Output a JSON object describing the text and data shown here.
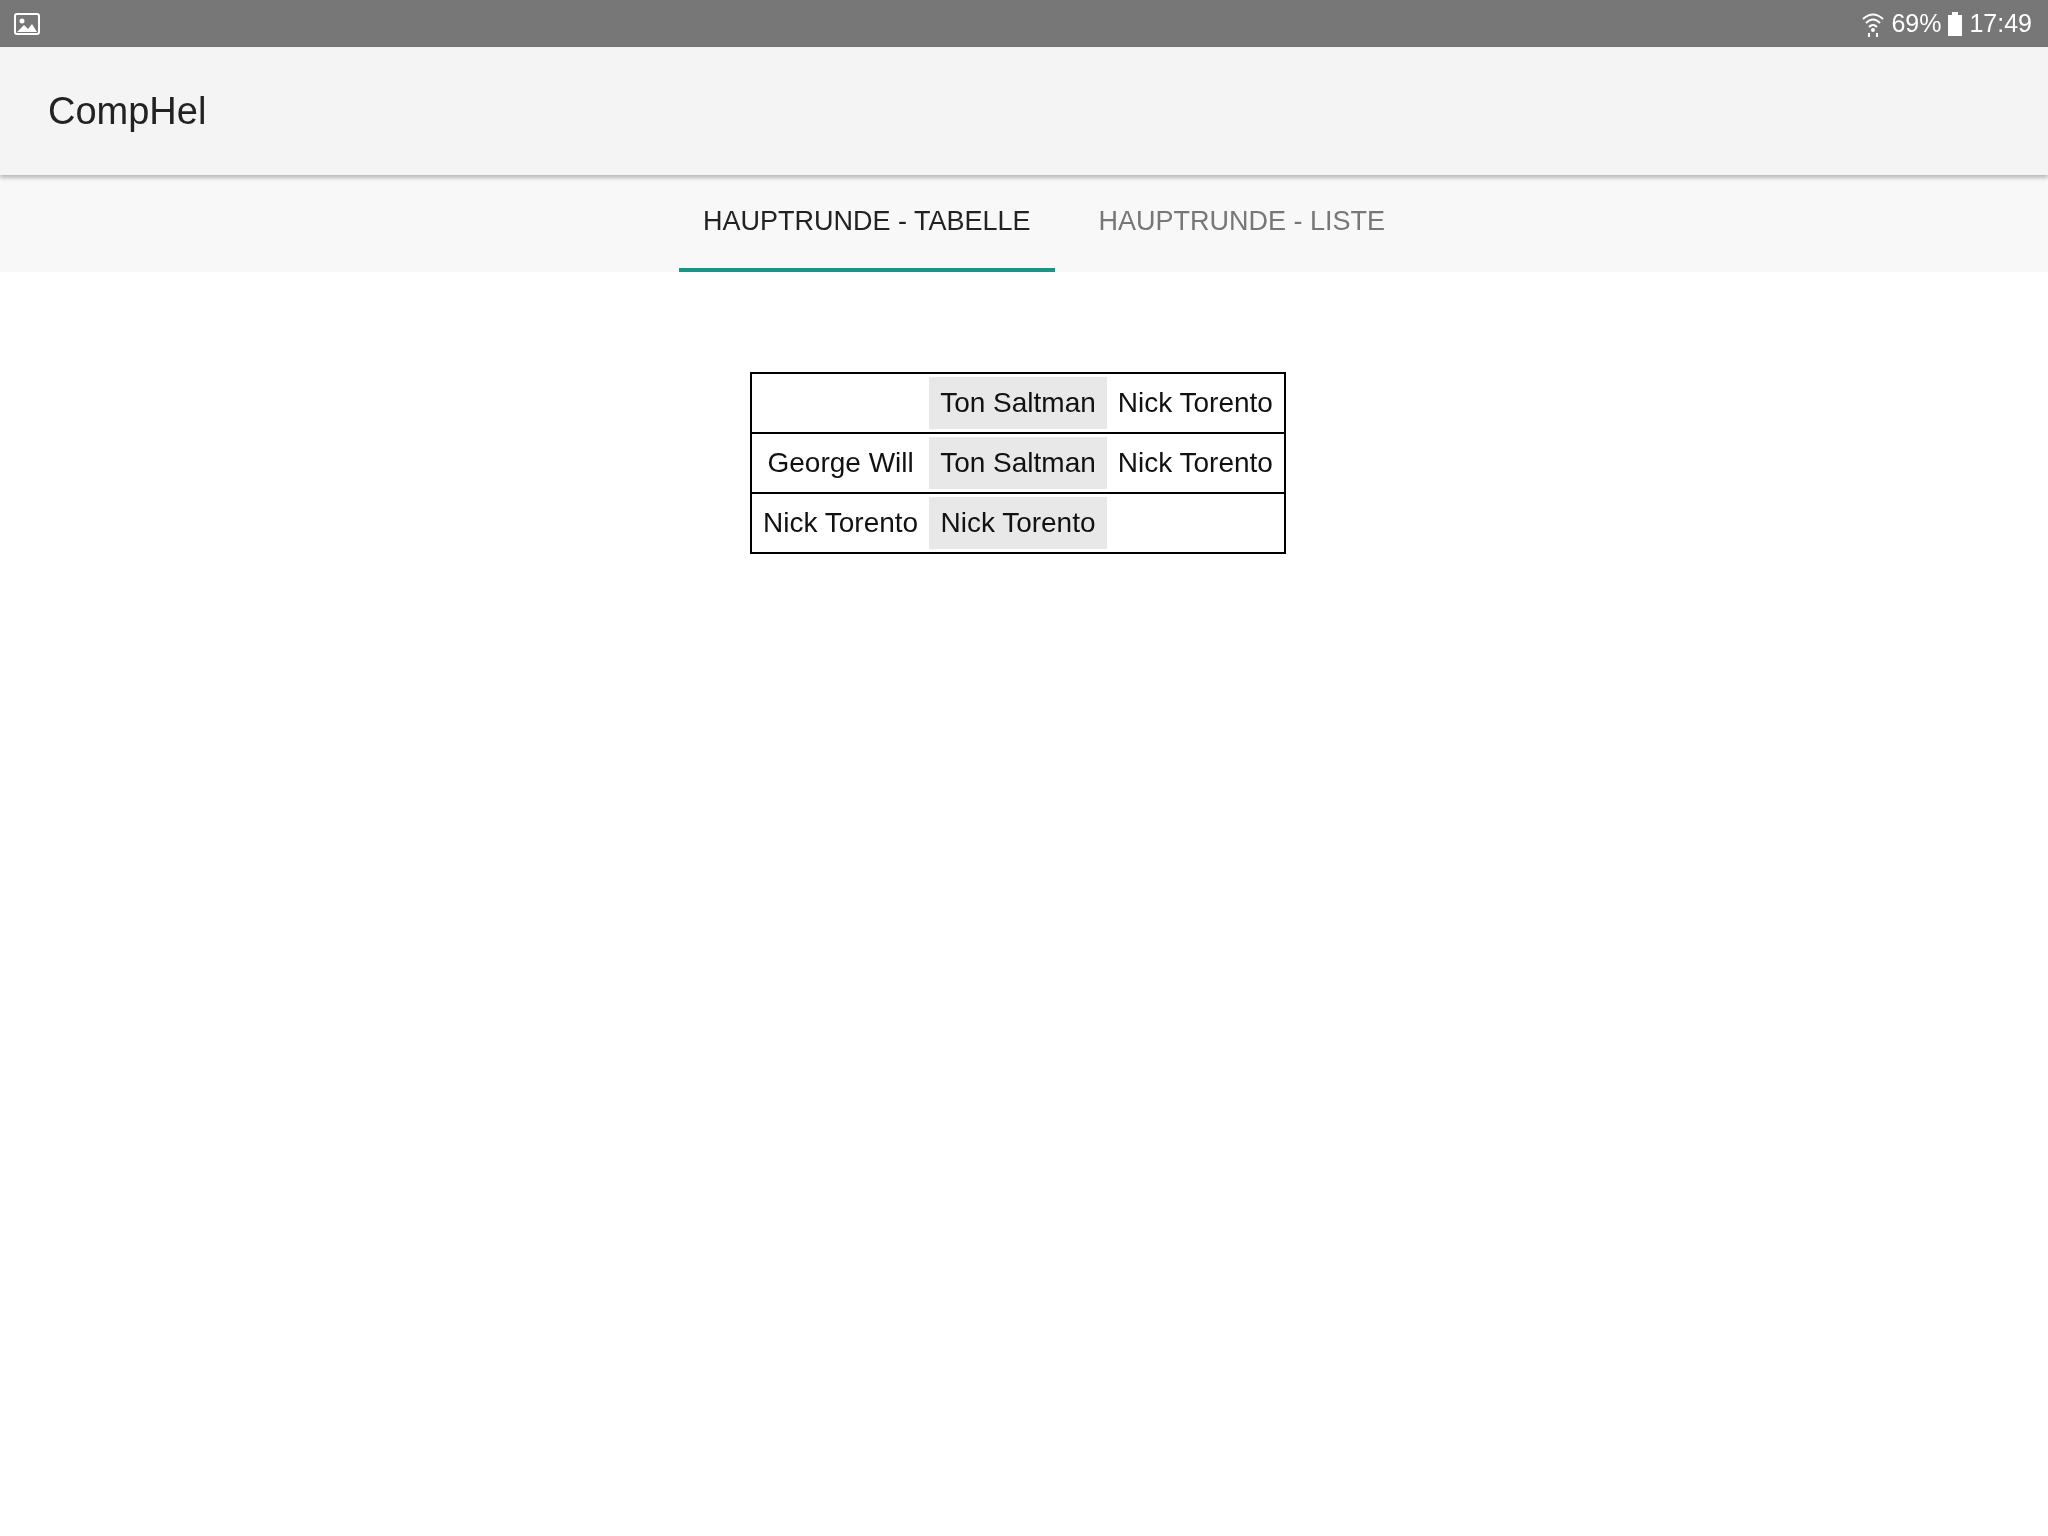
{
  "status_bar": {
    "battery": "69%",
    "time": "17:49"
  },
  "app_bar": {
    "title": "CompHel"
  },
  "tabs": [
    {
      "label": "HAUPTRUNDE - TABELLE",
      "selected": true
    },
    {
      "label": "HAUPTRUNDE - LISTE",
      "selected": false
    }
  ],
  "table": {
    "rows": [
      [
        null,
        {
          "text": "Ton Saltman",
          "shaded": true
        },
        {
          "text": "Nick Torento",
          "shaded": false
        }
      ],
      [
        {
          "text": "George Will",
          "shaded": false
        },
        {
          "text": "Ton Saltman",
          "shaded": true
        },
        {
          "text": "Nick Torento",
          "shaded": false
        }
      ],
      [
        {
          "text": "Nick Torento",
          "shaded": false
        },
        {
          "text": "Nick Torento",
          "shaded": true
        },
        null
      ]
    ]
  }
}
